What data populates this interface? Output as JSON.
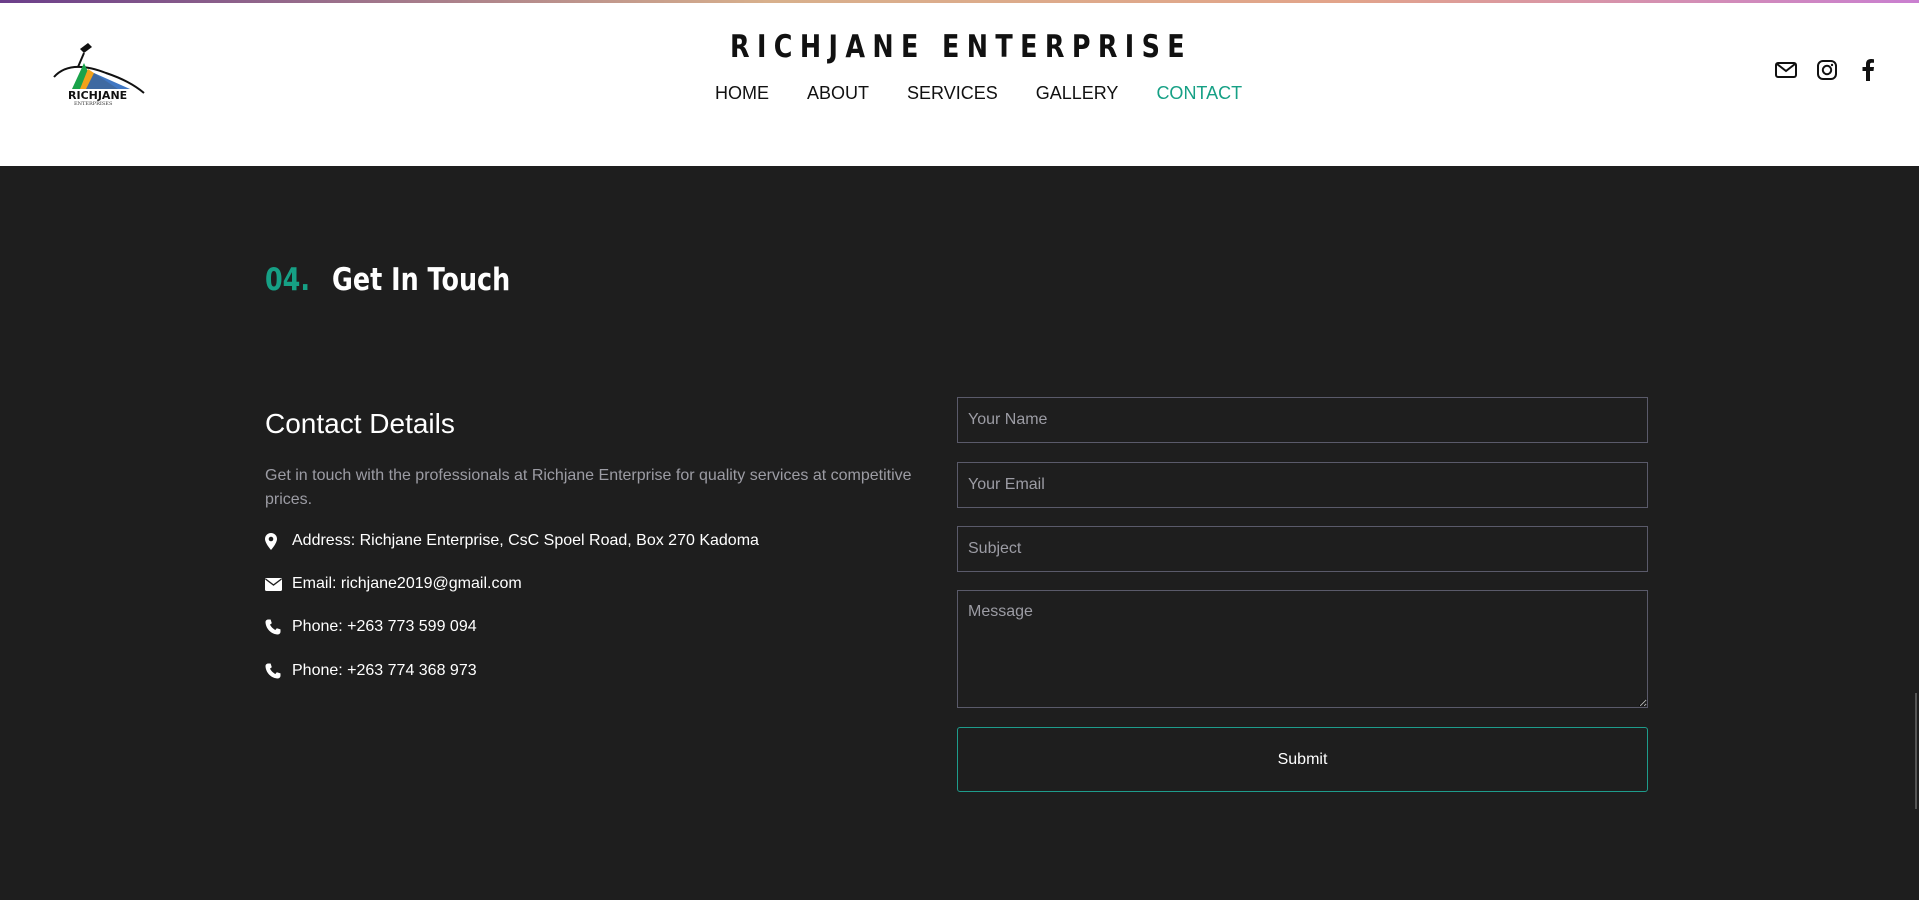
{
  "header": {
    "title": "RICHJANE ENTERPRISE",
    "logo_text": "RICHJANE",
    "logo_subtext": "ENTERPRISES",
    "nav": [
      {
        "label": "HOME"
      },
      {
        "label": "ABOUT"
      },
      {
        "label": "SERVICES"
      },
      {
        "label": "GALLERY"
      },
      {
        "label": "CONTACT",
        "active": true
      }
    ],
    "social_icons": [
      "envelope-icon",
      "instagram-icon",
      "facebook-icon"
    ],
    "accent_color": "#16a085"
  },
  "section": {
    "number": "04.",
    "title": "Get In Touch"
  },
  "contact": {
    "heading": "Contact Details",
    "description": "Get in touch with the professionals at Richjane Enterprise for quality services at competitive prices.",
    "details": [
      {
        "icon": "map-marker-icon",
        "text": "Address: Richjane Enterprise, CsC Spoel Road, Box 270 Kadoma"
      },
      {
        "icon": "envelope-icon",
        "text": "Email: richjane2019@gmail.com"
      },
      {
        "icon": "phone-icon",
        "text": "Phone: +263 773 599 094"
      },
      {
        "icon": "phone-icon",
        "text": "Phone: +263 774 368 973"
      }
    ]
  },
  "form": {
    "name_placeholder": "Your Name",
    "email_placeholder": "Your Email",
    "subject_placeholder": "Subject",
    "message_placeholder": "Message",
    "submit_label": "Submit"
  }
}
